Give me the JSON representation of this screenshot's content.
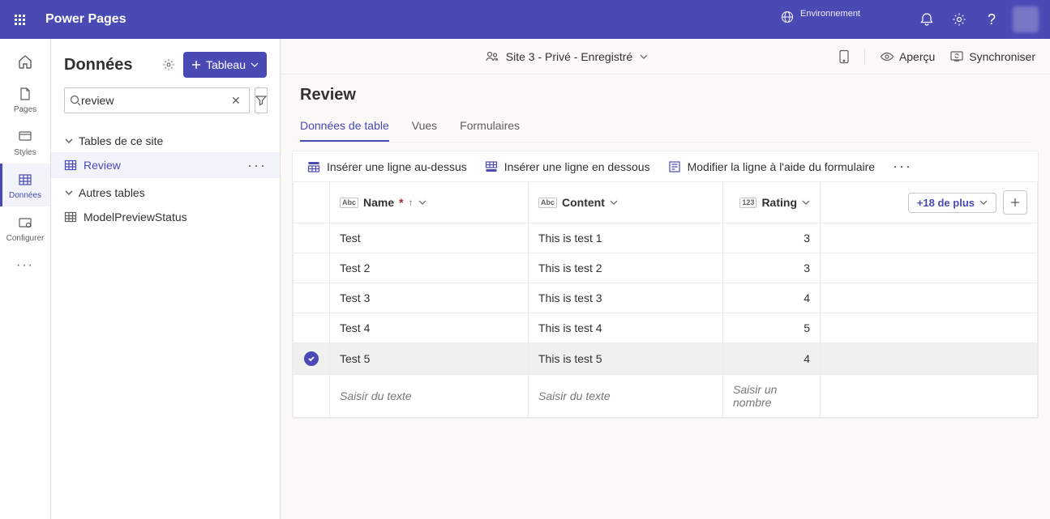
{
  "topbar": {
    "app_title": "Power Pages",
    "env_label": "Environnement",
    "env_value": ""
  },
  "rail": {
    "pages": "Pages",
    "styles": "Styles",
    "data": "Données",
    "configure": "Configurer"
  },
  "left": {
    "title": "Données",
    "new_btn": "Tableau",
    "search_value": "review",
    "search_placeholder": "",
    "section_site_tables": "Tables de ce site",
    "item_review": "Review",
    "section_other_tables": "Autres tables",
    "item_model": "ModelPreviewStatus"
  },
  "sitebar": {
    "site_label": "Site 3 - Privé - Enregistré",
    "preview": "Aperçu",
    "sync": "Synchroniser"
  },
  "page": {
    "title": "Review",
    "tabs": {
      "data": "Données de table",
      "views": "Vues",
      "forms": "Formulaires"
    }
  },
  "grid": {
    "cmd_insert_above": "Insérer une ligne au-dessus",
    "cmd_insert_below": "Insérer une ligne en dessous",
    "cmd_edit_form": "Modifier la ligne à l'aide du formulaire",
    "col_name": "Name",
    "col_content": "Content",
    "col_rating": "Rating",
    "more_cols": "+18 de plus",
    "rows": [
      {
        "name": "Test",
        "content": "This is test 1",
        "rating": "3",
        "selected": false
      },
      {
        "name": "Test 2",
        "content": "This is test 2",
        "rating": "3",
        "selected": false
      },
      {
        "name": "Test 3",
        "content": "This is test 3",
        "rating": "4",
        "selected": false
      },
      {
        "name": "Test 4",
        "content": "This is test 4",
        "rating": "5",
        "selected": false
      },
      {
        "name": "Test 5",
        "content": "This is test 5",
        "rating": "4",
        "selected": true
      }
    ],
    "ph_text": "Saisir du texte",
    "ph_number": "Saisir un nombre"
  }
}
